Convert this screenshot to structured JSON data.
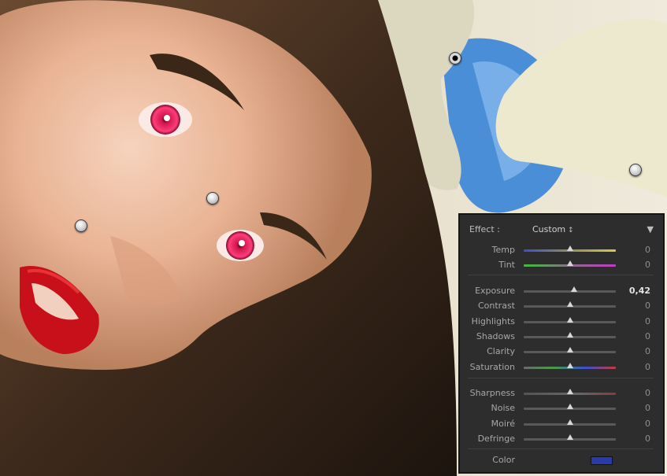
{
  "panel": {
    "effect_label": "Effect :",
    "effect_value": "Custom",
    "collapse_icon": "triangle-down-icon",
    "groups": [
      [
        {
          "name": "Temp",
          "value": "0",
          "level": 0.5,
          "track": "temp"
        },
        {
          "name": "Tint",
          "value": "0",
          "level": 0.5,
          "track": "tint"
        }
      ],
      [
        {
          "name": "Exposure",
          "value": "0,42",
          "level": 0.55,
          "track": "plain",
          "highlight": true
        },
        {
          "name": "Contrast",
          "value": "0",
          "level": 0.5,
          "track": "plain"
        },
        {
          "name": "Highlights",
          "value": "0",
          "level": 0.5,
          "track": "plain"
        },
        {
          "name": "Shadows",
          "value": "0",
          "level": 0.5,
          "track": "plain"
        },
        {
          "name": "Clarity",
          "value": "0",
          "level": 0.5,
          "track": "plain"
        },
        {
          "name": "Saturation",
          "value": "0",
          "level": 0.5,
          "track": "saturation"
        }
      ],
      [
        {
          "name": "Sharpness",
          "value": "0",
          "level": 0.5,
          "track": "sharp"
        },
        {
          "name": "Noise",
          "value": "0",
          "level": 0.5,
          "track": "plain"
        },
        {
          "name": "Moiré",
          "value": "0",
          "level": 0.5,
          "track": "plain"
        },
        {
          "name": "Defringe",
          "value": "0",
          "level": 0.5,
          "track": "plain"
        }
      ]
    ],
    "color_label": "Color",
    "color_swatch": "#2a3aa8"
  },
  "pins": [
    {
      "name": "adjustment-pin-flower",
      "active": true
    },
    {
      "name": "adjustment-pin-background",
      "active": false
    },
    {
      "name": "adjustment-pin-forehead",
      "active": false
    },
    {
      "name": "adjustment-pin-cheek",
      "active": false
    }
  ]
}
